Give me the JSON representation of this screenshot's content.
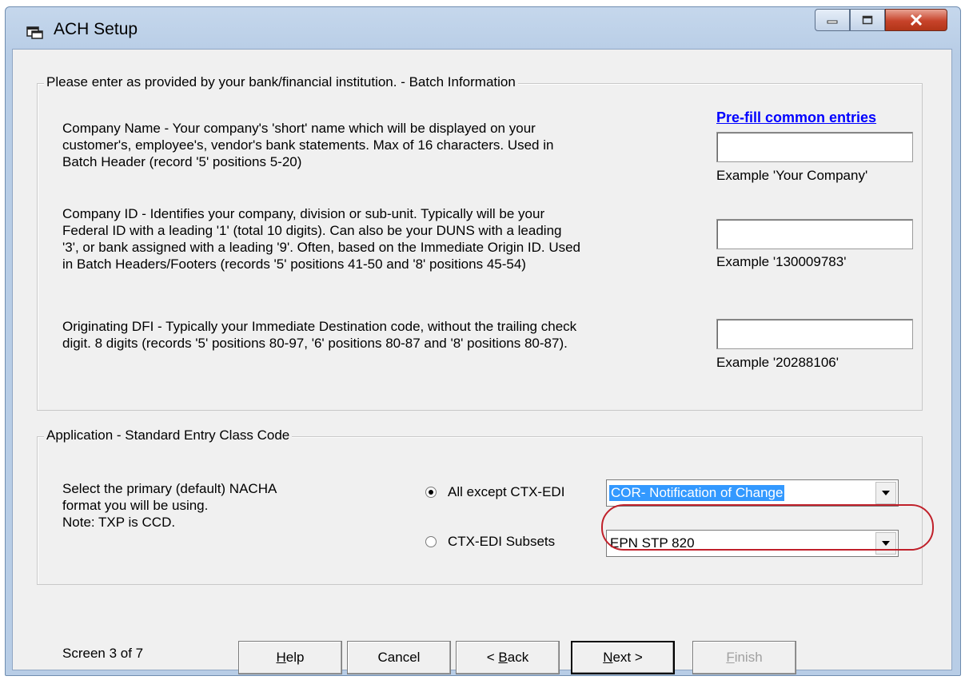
{
  "window": {
    "title": "ACH Setup"
  },
  "batch_group": {
    "title": "Please enter as provided by your bank/financial institution. - Batch Information",
    "prefill_link": "Pre-fill common entries",
    "company_name": {
      "desc": [
        "Company Name - Your company's 'short' name which will be displayed on your",
        "customer's, employee's, vendor's bank statements. Max of 16 characters.  Used in",
        "Batch Header (record '5' positions 5-20)"
      ],
      "value": "",
      "example": "Example 'Your Company'"
    },
    "company_id": {
      "desc": [
        "Company ID - Identifies your company, division or sub-unit.  Typically will be your",
        "Federal ID with a leading '1' (total 10 digits).   Can also be your DUNS with a leading",
        "'3', or bank assigned with a leading '9'. Often, based on the Immediate Origin ID. Used",
        "in Batch Headers/Footers (records '5' positions 41-50 and '8' positions 45-54)"
      ],
      "value": "",
      "example": "Example '130009783'"
    },
    "originating_dfi": {
      "desc": [
        "Originating DFI - Typically your Immediate Destination code, without the trailing check",
        "digit. 8 digits (records '5' positions 80-97, '6' positions 80-87 and '8' positions 80-87)."
      ],
      "value": "",
      "example": "Example '20288106'"
    }
  },
  "sec_group": {
    "title": "Application - Standard Entry Class Code",
    "desc": [
      "Select the primary (default) NACHA",
      "format you will be using.",
      "Note: TXP is CCD."
    ],
    "radio_all": {
      "label": "All except CTX-EDI",
      "checked": true
    },
    "radio_ctx": {
      "label": "CTX-EDI Subsets",
      "checked": false
    },
    "combo_all": "COR- Notification of Change",
    "combo_ctx": "EPN STP 820"
  },
  "footer": {
    "screen": "Screen 3 of 7",
    "help": {
      "accel": "H",
      "rest": "elp"
    },
    "cancel": "Cancel",
    "back": {
      "pre": "< ",
      "accel": "B",
      "rest": "ack"
    },
    "next": {
      "accel": "N",
      "rest": "ext >"
    },
    "finish": {
      "accel": "F",
      "rest": "inish"
    }
  }
}
